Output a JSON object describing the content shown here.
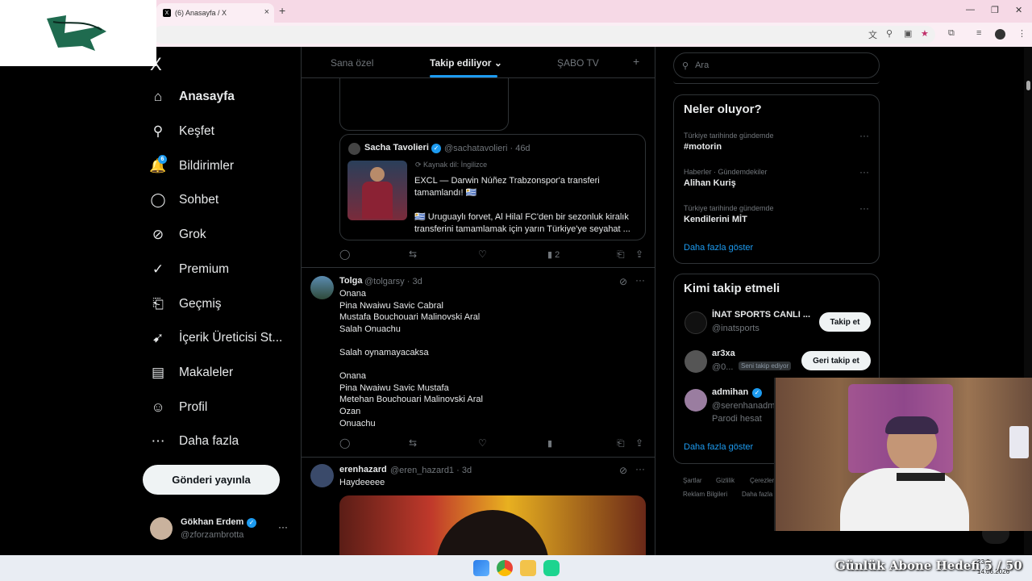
{
  "browser": {
    "tab_title": "(6) Anasayfa / X",
    "tab_close": "×",
    "new_tab": "+",
    "win_min": "—",
    "win_max": "❐",
    "win_close": "✕"
  },
  "nav": {
    "logo": "X",
    "items": [
      {
        "label": "Anasayfa",
        "icon": "home-icon",
        "glyph": "⌂"
      },
      {
        "label": "Keşfet",
        "icon": "search-icon",
        "glyph": "⚲"
      },
      {
        "label": "Bildirimler",
        "icon": "bell-icon",
        "glyph": "🔔",
        "badge": "6"
      },
      {
        "label": "Sohbet",
        "icon": "chat-icon",
        "glyph": "◯"
      },
      {
        "label": "Grok",
        "icon": "grok-icon",
        "glyph": "⊘"
      },
      {
        "label": "Premium",
        "icon": "premium-icon",
        "glyph": "✓"
      },
      {
        "label": "Geçmiş",
        "icon": "bookmark-icon",
        "glyph": "⎗"
      },
      {
        "label": "İçerik Üreticisi St...",
        "icon": "rocket-icon",
        "glyph": "➹"
      },
      {
        "label": "Makaleler",
        "icon": "article-icon",
        "glyph": "▤"
      },
      {
        "label": "Profil",
        "icon": "profile-icon",
        "glyph": "☺"
      },
      {
        "label": "Daha fazla",
        "icon": "more-icon",
        "glyph": "⋯"
      }
    ],
    "post_button": "Gönderi yayınla",
    "profile": {
      "name": "Gökhan Erdem",
      "handle": "@zforzambrotta",
      "more": "···"
    }
  },
  "timeline": {
    "tabs": [
      "Sana özel",
      "Takip ediliyor",
      "ŞABO TV"
    ],
    "add_tab": "+",
    "quote": {
      "name": "Sacha Tavolieri",
      "handle": "@sachatavolieri · 46d",
      "source_lang": "Kaynak dil: İngilizce",
      "line1": "EXCL — Darwin Núñez Trabzonspor'a transferi tamamlandı! 🇺🇾",
      "line2": "🇺🇾 Uruguaylı forvet, Al Hilal FC'den bir sezonluk kiralık transferini tamamlamak için yarın Türkiye'ye seyahat ..."
    },
    "views_1": "2",
    "tweet2": {
      "name": "Tolga",
      "handle": "@tolgarsy · 3d",
      "text": "Onana\nPina Nwaiwu Savic Cabral\nMustafa Bouchouari Malinovski  Aral\nSalah Onuachu\n\nSalah oynamayacaksa\n\nOnana\nPina Nwaiwu Savic Mustafa\nMetehan Bouchouari Malinovski  Aral\nOzan\nOnuachu"
    },
    "tweet3": {
      "name": "erenhazard",
      "handle": "@eren_hazard1 · 3d",
      "text": "Haydeeeee"
    }
  },
  "right": {
    "search_placeholder": "Ara",
    "trends_title": "Neler oluyor?",
    "trends": [
      {
        "context": "Türkiye tarihinde gündemde",
        "name": "#motorin"
      },
      {
        "context": "Haberler · Gündemdekiler",
        "name": "Alihan Kuriş"
      },
      {
        "context": "Türkiye tarihinde gündemde",
        "name": "Kendilerini MİT"
      }
    ],
    "show_more": "Daha fazla göster",
    "who_title": "Kimi takip etmeli",
    "who": [
      {
        "name": "İNAT SPORTS CANLI ...",
        "handle": "@inatsports",
        "button": "Takip et"
      },
      {
        "name": "ar3xa",
        "handle": "@0...",
        "badge": "Seni takip ediyor",
        "button": "Geri takip et"
      },
      {
        "name": "admihan",
        "handle": "@serenhanadm",
        "note": "Parodi hesat"
      }
    ],
    "who_more": "Daha fazla göster",
    "footer": [
      "Şartlar",
      "Gizlilik",
      "Çerezler",
      "Reklam Bilgileri",
      "Daha fazla"
    ]
  },
  "ticker": "Günlük Abone Hedefi 5 / 50",
  "clock": {
    "time": "23:?",
    "date": "14.06.2026"
  },
  "colors": {
    "accent": "#1d9bf0",
    "bg": "#000000",
    "border": "#2f3336"
  }
}
